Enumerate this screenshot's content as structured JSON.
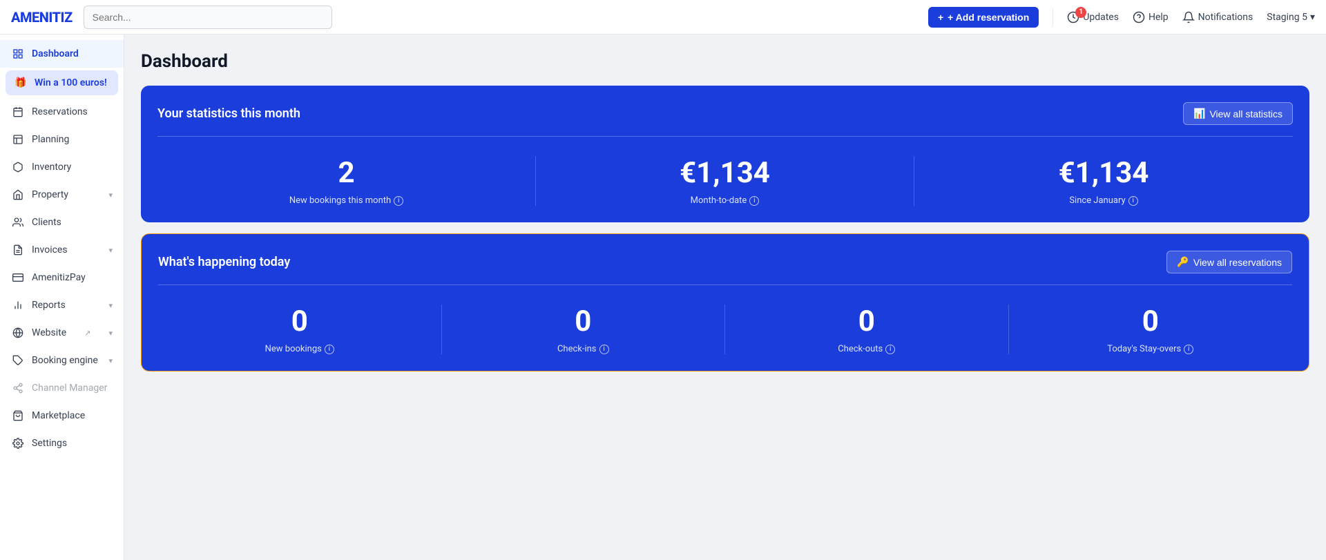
{
  "logo": "AMENITIZ",
  "search": {
    "placeholder": "Search..."
  },
  "navbar": {
    "add_reservation": "+ Add reservation",
    "updates": "Updates",
    "updates_badge": "1",
    "help": "Help",
    "notifications": "Notifications",
    "staging": "Staging 5"
  },
  "sidebar": {
    "items": [
      {
        "id": "dashboard",
        "label": "Dashboard",
        "icon": "grid",
        "active": true,
        "has_chevron": false
      },
      {
        "id": "win",
        "label": "Win a 100 euros!",
        "icon": "gift",
        "special": true,
        "has_chevron": false
      },
      {
        "id": "reservations",
        "label": "Reservations",
        "icon": "calendar",
        "has_chevron": false
      },
      {
        "id": "planning",
        "label": "Planning",
        "icon": "layout",
        "has_chevron": false
      },
      {
        "id": "inventory",
        "label": "Inventory",
        "icon": "box",
        "has_chevron": false
      },
      {
        "id": "property",
        "label": "Property",
        "icon": "home",
        "has_chevron": true
      },
      {
        "id": "clients",
        "label": "Clients",
        "icon": "users",
        "has_chevron": false
      },
      {
        "id": "invoices",
        "label": "Invoices",
        "icon": "file-text",
        "has_chevron": true
      },
      {
        "id": "amenitizpay",
        "label": "AmenitizPay",
        "icon": "credit-card",
        "has_chevron": false
      },
      {
        "id": "reports",
        "label": "Reports",
        "icon": "bar-chart",
        "has_chevron": true
      },
      {
        "id": "website",
        "label": "Website",
        "icon": "globe",
        "has_chevron": true,
        "external": true
      },
      {
        "id": "booking-engine",
        "label": "Booking engine",
        "icon": "tag",
        "has_chevron": true
      },
      {
        "id": "channel-manager",
        "label": "Channel Manager",
        "icon": "share",
        "disabled": true,
        "has_chevron": false
      },
      {
        "id": "marketplace",
        "label": "Marketplace",
        "icon": "shopping-bag",
        "has_chevron": false
      },
      {
        "id": "settings",
        "label": "Settings",
        "icon": "settings",
        "has_chevron": false
      }
    ]
  },
  "page_title": "Dashboard",
  "statistics": {
    "section_title": "Your statistics this month",
    "view_all_label": "View all statistics",
    "stats": [
      {
        "id": "new-bookings",
        "value": "2",
        "label": "New bookings this month",
        "has_info": true
      },
      {
        "id": "month-to-date",
        "value": "€1,134",
        "label": "Month-to-date",
        "has_info": true
      },
      {
        "id": "since-january",
        "value": "€1,134",
        "label": "Since January",
        "has_info": true
      }
    ]
  },
  "today": {
    "section_title": "What's happening today",
    "view_all_label": "View all reservations",
    "stats": [
      {
        "id": "new-bookings-today",
        "value": "0",
        "label": "New bookings",
        "has_info": true
      },
      {
        "id": "check-ins",
        "value": "0",
        "label": "Check-ins",
        "has_info": true
      },
      {
        "id": "check-outs",
        "value": "0",
        "label": "Check-outs",
        "has_info": true
      },
      {
        "id": "stay-overs",
        "value": "0",
        "label": "Today's Stay-overs",
        "has_info": true
      }
    ]
  }
}
